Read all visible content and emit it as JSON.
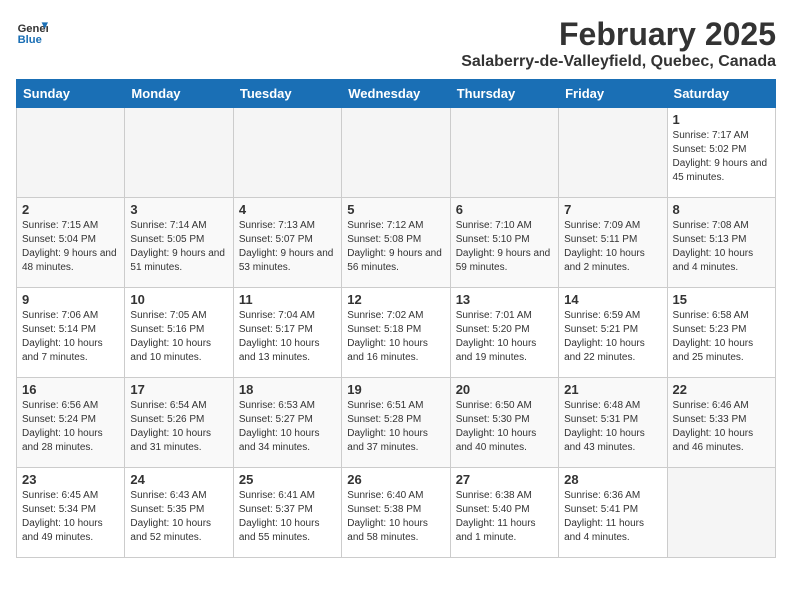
{
  "header": {
    "logo_line1": "General",
    "logo_line2": "Blue",
    "month": "February 2025",
    "location": "Salaberry-de-Valleyfield, Quebec, Canada"
  },
  "weekdays": [
    "Sunday",
    "Monday",
    "Tuesday",
    "Wednesday",
    "Thursday",
    "Friday",
    "Saturday"
  ],
  "weeks": [
    [
      {
        "day": "",
        "info": ""
      },
      {
        "day": "",
        "info": ""
      },
      {
        "day": "",
        "info": ""
      },
      {
        "day": "",
        "info": ""
      },
      {
        "day": "",
        "info": ""
      },
      {
        "day": "",
        "info": ""
      },
      {
        "day": "1",
        "info": "Sunrise: 7:17 AM\nSunset: 5:02 PM\nDaylight: 9 hours and 45 minutes."
      }
    ],
    [
      {
        "day": "2",
        "info": "Sunrise: 7:15 AM\nSunset: 5:04 PM\nDaylight: 9 hours and 48 minutes."
      },
      {
        "day": "3",
        "info": "Sunrise: 7:14 AM\nSunset: 5:05 PM\nDaylight: 9 hours and 51 minutes."
      },
      {
        "day": "4",
        "info": "Sunrise: 7:13 AM\nSunset: 5:07 PM\nDaylight: 9 hours and 53 minutes."
      },
      {
        "day": "5",
        "info": "Sunrise: 7:12 AM\nSunset: 5:08 PM\nDaylight: 9 hours and 56 minutes."
      },
      {
        "day": "6",
        "info": "Sunrise: 7:10 AM\nSunset: 5:10 PM\nDaylight: 9 hours and 59 minutes."
      },
      {
        "day": "7",
        "info": "Sunrise: 7:09 AM\nSunset: 5:11 PM\nDaylight: 10 hours and 2 minutes."
      },
      {
        "day": "8",
        "info": "Sunrise: 7:08 AM\nSunset: 5:13 PM\nDaylight: 10 hours and 4 minutes."
      }
    ],
    [
      {
        "day": "9",
        "info": "Sunrise: 7:06 AM\nSunset: 5:14 PM\nDaylight: 10 hours and 7 minutes."
      },
      {
        "day": "10",
        "info": "Sunrise: 7:05 AM\nSunset: 5:16 PM\nDaylight: 10 hours and 10 minutes."
      },
      {
        "day": "11",
        "info": "Sunrise: 7:04 AM\nSunset: 5:17 PM\nDaylight: 10 hours and 13 minutes."
      },
      {
        "day": "12",
        "info": "Sunrise: 7:02 AM\nSunset: 5:18 PM\nDaylight: 10 hours and 16 minutes."
      },
      {
        "day": "13",
        "info": "Sunrise: 7:01 AM\nSunset: 5:20 PM\nDaylight: 10 hours and 19 minutes."
      },
      {
        "day": "14",
        "info": "Sunrise: 6:59 AM\nSunset: 5:21 PM\nDaylight: 10 hours and 22 minutes."
      },
      {
        "day": "15",
        "info": "Sunrise: 6:58 AM\nSunset: 5:23 PM\nDaylight: 10 hours and 25 minutes."
      }
    ],
    [
      {
        "day": "16",
        "info": "Sunrise: 6:56 AM\nSunset: 5:24 PM\nDaylight: 10 hours and 28 minutes."
      },
      {
        "day": "17",
        "info": "Sunrise: 6:54 AM\nSunset: 5:26 PM\nDaylight: 10 hours and 31 minutes."
      },
      {
        "day": "18",
        "info": "Sunrise: 6:53 AM\nSunset: 5:27 PM\nDaylight: 10 hours and 34 minutes."
      },
      {
        "day": "19",
        "info": "Sunrise: 6:51 AM\nSunset: 5:28 PM\nDaylight: 10 hours and 37 minutes."
      },
      {
        "day": "20",
        "info": "Sunrise: 6:50 AM\nSunset: 5:30 PM\nDaylight: 10 hours and 40 minutes."
      },
      {
        "day": "21",
        "info": "Sunrise: 6:48 AM\nSunset: 5:31 PM\nDaylight: 10 hours and 43 minutes."
      },
      {
        "day": "22",
        "info": "Sunrise: 6:46 AM\nSunset: 5:33 PM\nDaylight: 10 hours and 46 minutes."
      }
    ],
    [
      {
        "day": "23",
        "info": "Sunrise: 6:45 AM\nSunset: 5:34 PM\nDaylight: 10 hours and 49 minutes."
      },
      {
        "day": "24",
        "info": "Sunrise: 6:43 AM\nSunset: 5:35 PM\nDaylight: 10 hours and 52 minutes."
      },
      {
        "day": "25",
        "info": "Sunrise: 6:41 AM\nSunset: 5:37 PM\nDaylight: 10 hours and 55 minutes."
      },
      {
        "day": "26",
        "info": "Sunrise: 6:40 AM\nSunset: 5:38 PM\nDaylight: 10 hours and 58 minutes."
      },
      {
        "day": "27",
        "info": "Sunrise: 6:38 AM\nSunset: 5:40 PM\nDaylight: 11 hours and 1 minute."
      },
      {
        "day": "28",
        "info": "Sunrise: 6:36 AM\nSunset: 5:41 PM\nDaylight: 11 hours and 4 minutes."
      },
      {
        "day": "",
        "info": ""
      }
    ]
  ]
}
